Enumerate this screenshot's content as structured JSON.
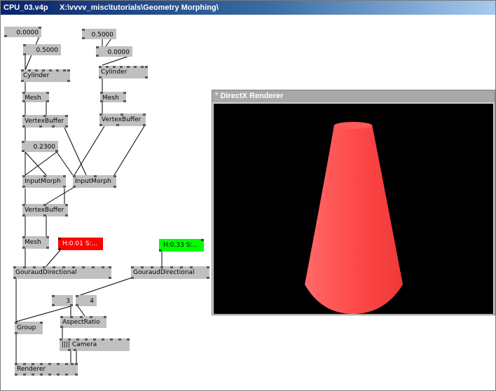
{
  "window": {
    "filename": "CPU_03.v4p",
    "path": "X:\\vvvv_misc\\tutorials\\Geometry Morphing\\"
  },
  "renderer_window": {
    "title": "° DirectX Renderer",
    "background": "#000000",
    "object_color": "#ff4040"
  },
  "nodes": {
    "io_0000_a": "0.0000",
    "io_05000_a": "0.5000",
    "io_05000_b": "0.5000",
    "io_0000_b": "0.0000",
    "cylinder_1": "Cylinder",
    "cylinder_2": "Cylinder",
    "mesh_1": "Mesh",
    "mesh_2": "Mesh",
    "vertexbuffer_1": "VertexBuffer",
    "vertexbuffer_2": "VertexBuffer",
    "io_02300": "0.2300",
    "inputmorph_1": "InputMorph",
    "inputmorph_2": "InputMorph",
    "vertexbuffer_3": "VertexBuffer",
    "mesh_3": "Mesh",
    "color_red": "H:0.01  S:...",
    "color_green": "H:0.33  S:...",
    "gouraud_1": "GouraudDirectional",
    "gouraud_2": "GouraudDirectional",
    "io_3": "3",
    "io_4": "4",
    "group": "Group",
    "aspectratio": "AspectRatio",
    "camera": "|||| Camera",
    "renderer": "Renderer"
  },
  "colors": {
    "node": "#c0c0c0",
    "pin": "#5a5a5a",
    "red_node": "#ff0000",
    "green_node": "#00ff00"
  }
}
